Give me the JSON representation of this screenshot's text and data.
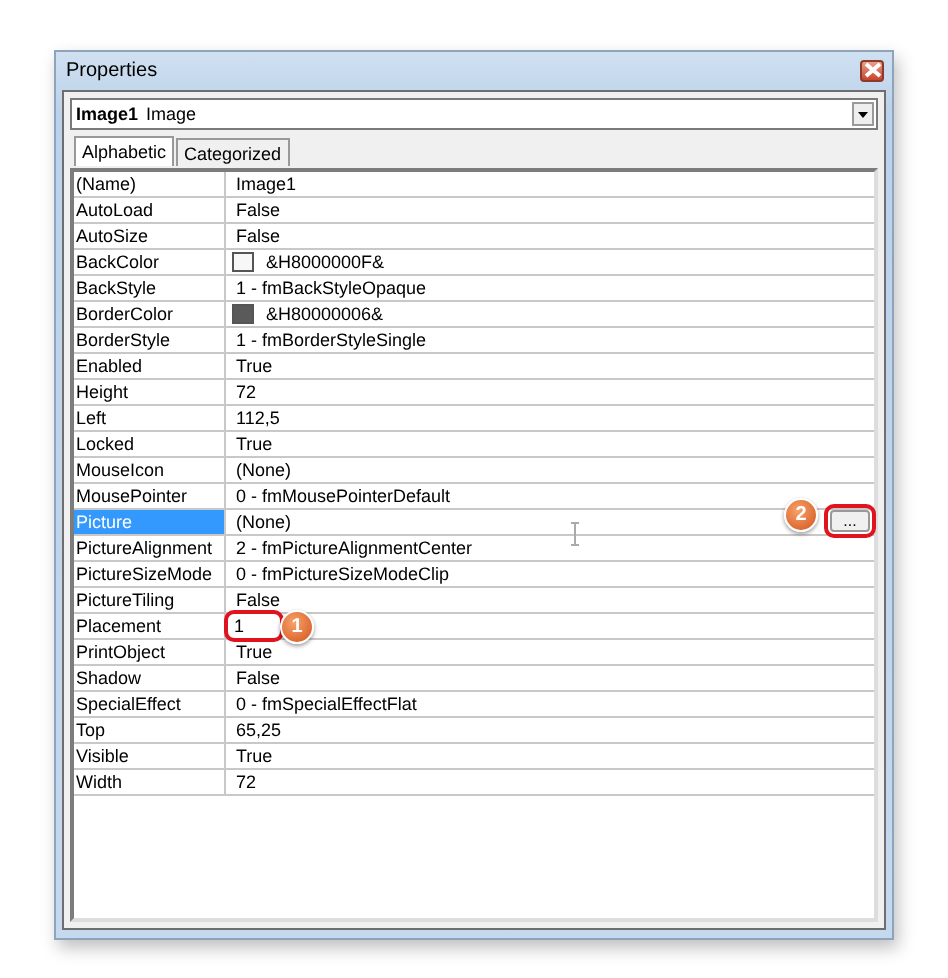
{
  "window": {
    "title": "Properties"
  },
  "object_selector": {
    "name": "Image1",
    "type": "Image"
  },
  "tabs": [
    {
      "label": "Alphabetic",
      "selected": true
    },
    {
      "label": "Categorized",
      "selected": false
    }
  ],
  "properties": [
    {
      "name": "(Name)",
      "value": "Image1",
      "kind": "text",
      "selected": false
    },
    {
      "name": "AutoLoad",
      "value": "False",
      "kind": "text",
      "selected": false
    },
    {
      "name": "AutoSize",
      "value": "False",
      "kind": "text",
      "selected": false
    },
    {
      "name": "BackColor",
      "value": "&H8000000F&",
      "kind": "color",
      "color": "#f7f7f7",
      "selected": false
    },
    {
      "name": "BackStyle",
      "value": "1 - fmBackStyleOpaque",
      "kind": "text",
      "selected": false
    },
    {
      "name": "BorderColor",
      "value": "&H80000006&",
      "kind": "color",
      "color": "#5a5a5a",
      "selected": false
    },
    {
      "name": "BorderStyle",
      "value": "1 - fmBorderStyleSingle",
      "kind": "text",
      "selected": false
    },
    {
      "name": "Enabled",
      "value": "True",
      "kind": "text",
      "selected": false
    },
    {
      "name": "Height",
      "value": "72",
      "kind": "text",
      "selected": false
    },
    {
      "name": "Left",
      "value": "112,5",
      "kind": "text",
      "selected": false
    },
    {
      "name": "Locked",
      "value": "True",
      "kind": "text",
      "selected": false
    },
    {
      "name": "MouseIcon",
      "value": "(None)",
      "kind": "text",
      "selected": false
    },
    {
      "name": "MousePointer",
      "value": "0 - fmMousePointerDefault",
      "kind": "text",
      "selected": false
    },
    {
      "name": "Picture",
      "value": "(None)",
      "kind": "text",
      "selected": true,
      "button": "...",
      "button_highlighted": true,
      "badge": "2"
    },
    {
      "name": "PictureAlignment",
      "value": "2 - fmPictureAlignmentCenter",
      "kind": "text",
      "selected": false
    },
    {
      "name": "PictureSizeMode",
      "value": "0 - fmPictureSizeModeClip",
      "kind": "text",
      "selected": false
    },
    {
      "name": "PictureTiling",
      "value": "False",
      "kind": "text",
      "selected": false
    },
    {
      "name": "Placement",
      "value": "1",
      "kind": "text",
      "selected": false,
      "value_highlighted": true,
      "badge": "1"
    },
    {
      "name": "PrintObject",
      "value": "True",
      "kind": "text",
      "selected": false
    },
    {
      "name": "Shadow",
      "value": "False",
      "kind": "text",
      "selected": false
    },
    {
      "name": "SpecialEffect",
      "value": "0 - fmSpecialEffectFlat",
      "kind": "text",
      "selected": false
    },
    {
      "name": "Top",
      "value": "65,25",
      "kind": "text",
      "selected": false
    },
    {
      "name": "Visible",
      "value": "True",
      "kind": "text",
      "selected": false
    },
    {
      "name": "Width",
      "value": "72",
      "kind": "text",
      "selected": false
    }
  ]
}
